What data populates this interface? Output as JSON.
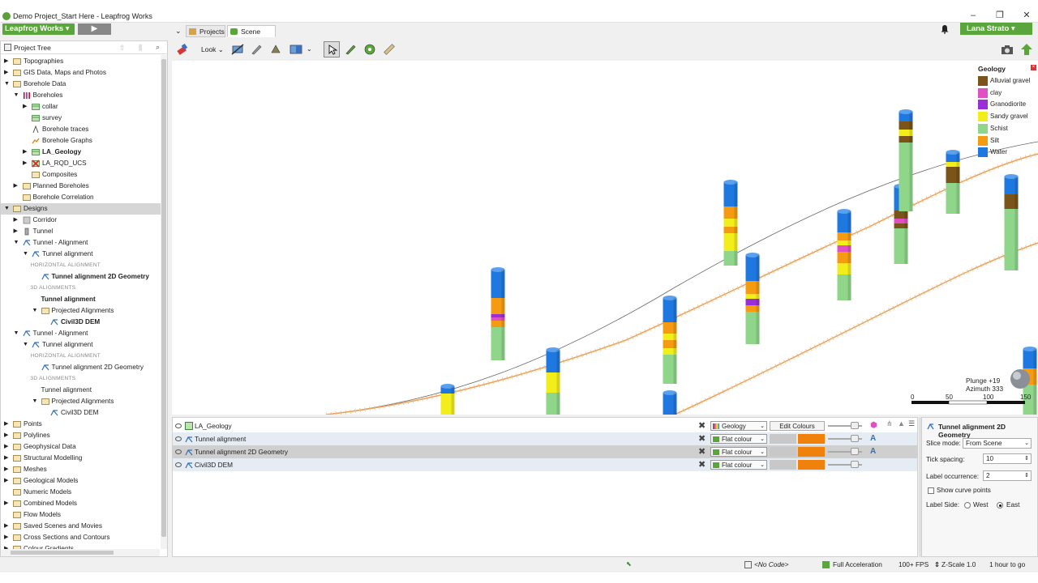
{
  "window": {
    "title": "Demo Project_Start Here - Leapfrog Works"
  },
  "brand": {
    "label": "Leapfrog Works ▾",
    "play": "▶"
  },
  "user": {
    "label": "Lana Strato ▾"
  },
  "tabs": [
    {
      "label": "Projects"
    },
    {
      "label": "Scene View"
    }
  ],
  "toolbar": {
    "look_label": "Look"
  },
  "project_tree": {
    "header": "Project Tree",
    "items": [
      {
        "label": "Topographies"
      },
      {
        "label": "GIS Data, Maps and Photos"
      },
      {
        "label": "Borehole Data"
      },
      {
        "label": "Boreholes"
      },
      {
        "label": "collar"
      },
      {
        "label": "survey"
      },
      {
        "label": "Borehole traces"
      },
      {
        "label": "Borehole Graphs"
      },
      {
        "label": "LA_Geology"
      },
      {
        "label": "LA_RQD_UCS"
      },
      {
        "label": "Composites"
      },
      {
        "label": "Planned Boreholes"
      },
      {
        "label": "Borehole Correlation"
      },
      {
        "label": "Designs"
      },
      {
        "label": "Corridor"
      },
      {
        "label": "Tunnel"
      },
      {
        "label": "Tunnel - Alignment"
      },
      {
        "label": "Tunnel alignment"
      },
      {
        "label": "HORIZONTAL ALIGNMENT"
      },
      {
        "label": "Tunnel alignment 2D Geometry"
      },
      {
        "label": "3D ALIGNMENTS"
      },
      {
        "label": "Tunnel alignment"
      },
      {
        "label": "Projected Alignments"
      },
      {
        "label": "Civil3D DEM"
      },
      {
        "label": "Tunnel - Alignment"
      },
      {
        "label": "Tunnel alignment"
      },
      {
        "label": "HORIZONTAL ALIGNMENT"
      },
      {
        "label": "Tunnel alignment 2D Geometry"
      },
      {
        "label": "3D ALIGNMENTS"
      },
      {
        "label": "Tunnel alignment"
      },
      {
        "label": "Projected Alignments"
      },
      {
        "label": "Civil3D DEM"
      },
      {
        "label": "Points"
      },
      {
        "label": "Polylines"
      },
      {
        "label": "Geophysical Data"
      },
      {
        "label": "Structural Modelling"
      },
      {
        "label": "Meshes"
      },
      {
        "label": "Geological Models"
      },
      {
        "label": "Numeric Models"
      },
      {
        "label": "Combined Models"
      },
      {
        "label": "Flow Models"
      },
      {
        "label": "Saved Scenes and Movies"
      },
      {
        "label": "Cross Sections and Contours"
      },
      {
        "label": "Colour Gradients"
      }
    ]
  },
  "legend": {
    "title": "Geology",
    "items": [
      {
        "label": "Alluvial gravel",
        "color": "#7a5418"
      },
      {
        "label": "clay",
        "color": "#e04fc4"
      },
      {
        "label": "Granodiorite",
        "color": "#9a2fd8"
      },
      {
        "label": "Sandy gravel",
        "color": "#f2ee1c"
      },
      {
        "label": "Schist",
        "color": "#8fd68a"
      },
      {
        "label": "Silt",
        "color": "#f59b12"
      },
      {
        "label": "Water",
        "color": "#1f78e0"
      }
    ]
  },
  "scene": {
    "plunge": "Plunge +19",
    "azimuth": "Azimuth 333",
    "scale_ticks": [
      "0",
      "50",
      "100",
      "150"
    ]
  },
  "shapes": [
    {
      "name": "LA_Geology",
      "mode": "Geology",
      "button": "Edit Colours"
    },
    {
      "name": "Tunnel alignment",
      "mode": "Flat colour"
    },
    {
      "name": "Tunnel alignment 2D Geometry",
      "mode": "Flat colour"
    },
    {
      "name": "Civil3D DEM",
      "mode": "Flat colour"
    }
  ],
  "properties": {
    "title": "Tunnel alignment 2D Geometry",
    "slice_mode_label": "Slice mode:",
    "slice_mode_value": "From Scene",
    "tick_spacing_label": "Tick spacing:",
    "tick_spacing_value": "10",
    "label_occurrence_label": "Label occurrence:",
    "label_occurrence_value": "2",
    "show_curve_points": "Show curve points",
    "label_side_label": "Label Side:",
    "west": "West",
    "east": "East"
  },
  "status": {
    "no_code": "<No Code>",
    "accel": "Full Acceleration",
    "fps": "100+ FPS",
    "zscale": "Z-Scale 1.0",
    "time": "1 hour to go"
  },
  "colors": {
    "brand_green": "#5ba53d",
    "orange": "#f0810a",
    "selection": "#d6d6d6"
  }
}
